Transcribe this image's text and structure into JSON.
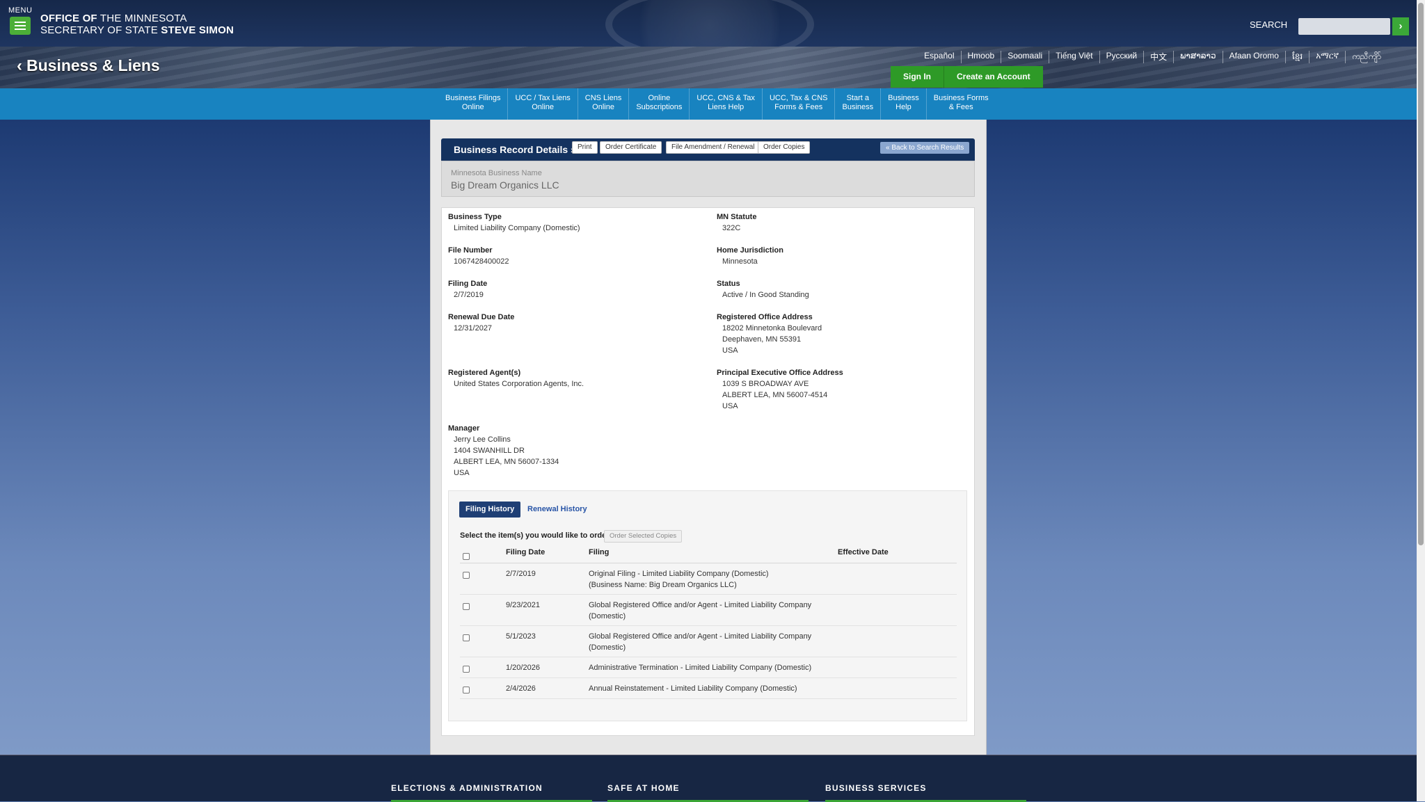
{
  "header": {
    "menu_label": "MENU",
    "office_line1_bold": "OFFICE OF",
    "office_line1_rest": " THE MINNESOTA",
    "office_line2_rest": "SECRETARY OF STATE ",
    "office_line2_bold": "STEVE SIMON",
    "search_label": "SEARCH",
    "search_placeholder": "",
    "search_go": "›"
  },
  "hero": {
    "title": "Business & Liens",
    "languages": [
      "Español",
      "Hmoob",
      "Soomaali",
      "Tiếng Việt",
      "Русский",
      "中文",
      "ພາສາລາວ",
      "Afaan Oromo",
      "ខ្មែរ",
      "አማርኛ",
      "ကညီကျိာ်"
    ],
    "sign_in": "Sign In",
    "create_account": "Create an Account"
  },
  "nav": [
    [
      "Business Filings",
      "Online"
    ],
    [
      "UCC / Tax Liens",
      "Online"
    ],
    [
      "CNS Liens",
      "Online"
    ],
    [
      "Online",
      "Subscriptions"
    ],
    [
      "UCC, CNS & Tax",
      "Liens Help"
    ],
    [
      "UCC, Tax & CNS",
      "Forms & Fees"
    ],
    [
      "Start a",
      "Business"
    ],
    [
      "Business",
      "Help"
    ],
    [
      "Business Forms",
      "& Fees"
    ]
  ],
  "record": {
    "title": "Business Record Details »",
    "print": "Print",
    "order_certificate": "Order Certificate",
    "file_amendment": "File Amendment / Renewal",
    "order_copies": "Order Copies",
    "back_to_search": "« Back to Search Results",
    "name_label": "Minnesota Business Name",
    "name_value": "Big Dream Organics LLC"
  },
  "fields": {
    "business_type": {
      "label": "Business Type",
      "value": "Limited Liability Company (Domestic)"
    },
    "mn_statute": {
      "label": "MN Statute",
      "value": "322C"
    },
    "file_number": {
      "label": "File Number",
      "value": "1067428400022"
    },
    "home_jurisdiction": {
      "label": "Home Jurisdiction",
      "value": "Minnesota"
    },
    "filing_date": {
      "label": "Filing Date",
      "value": "2/7/2019"
    },
    "status": {
      "label": "Status",
      "value": "Active / In Good Standing"
    },
    "renewal_due": {
      "label": "Renewal Due Date",
      "value": "12/31/2027"
    },
    "registered_office": {
      "label": "Registered Office Address",
      "lines": [
        "18202 Minnetonka Boulevard",
        "Deephaven, MN 55391",
        "USA"
      ]
    },
    "registered_agent": {
      "label": "Registered Agent(s)",
      "value": "United States Corporation Agents, Inc."
    },
    "principal_office": {
      "label": "Principal Executive Office Address",
      "lines": [
        "1039 S BROADWAY AVE",
        "ALBERT LEA, MN 56007-4514",
        "USA"
      ]
    },
    "manager": {
      "label": "Manager",
      "lines": [
        "Jerry Lee Collins",
        "1404 SWANHILL DR",
        "ALBERT LEA, MN 56007-1334",
        "USA"
      ]
    }
  },
  "history": {
    "tab_filing": "Filing History",
    "tab_renewal": "Renewal History",
    "select_text": "Select the item(s) you would like to order:",
    "order_selected": "Order Selected Copies",
    "columns": {
      "date": "Filing Date",
      "filing": "Filing",
      "effective": "Effective Date"
    },
    "rows": [
      {
        "date": "2/7/2019",
        "filing": [
          "Original Filing - Limited Liability Company (Domestic)",
          "(Business Name: Big Dream Organics LLC)"
        ],
        "effective": ""
      },
      {
        "date": "9/23/2021",
        "filing": [
          "Global Registered Office and/or Agent - Limited Liability Company",
          "(Domestic)"
        ],
        "effective": ""
      },
      {
        "date": "5/1/2023",
        "filing": [
          "Global Registered Office and/or Agent - Limited Liability Company",
          "(Domestic)"
        ],
        "effective": ""
      },
      {
        "date": "1/20/2026",
        "filing": [
          "Administrative Termination - Limited Liability Company (Domestic)"
        ],
        "effective": ""
      },
      {
        "date": "2/4/2026",
        "filing": [
          "Annual Reinstatement - Limited Liability Company (Domestic)"
        ],
        "effective": ""
      }
    ]
  },
  "footer": {
    "col1": "ELECTIONS & ADMINISTRATION",
    "col2": "SAFE AT HOME",
    "col3": "BUSINESS SERVICES"
  },
  "colors": {
    "accent_green": "#3ba838",
    "nav_blue": "#1883c0",
    "header_navy": "#14325f"
  }
}
